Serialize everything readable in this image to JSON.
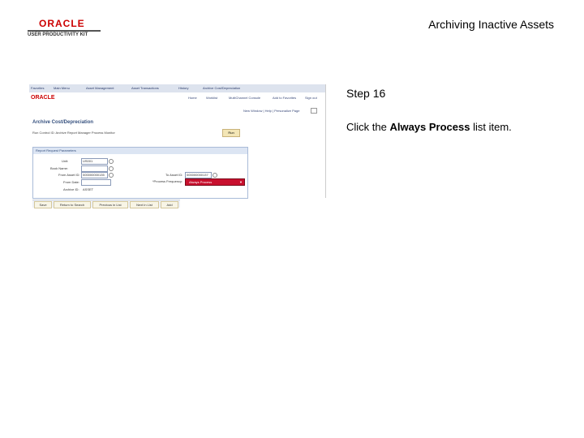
{
  "logo": {
    "brand": "ORACLE",
    "product": "USER PRODUCTIVITY KIT"
  },
  "header": {
    "title": "Archiving Inactive Assets"
  },
  "step": {
    "label": "Step 16"
  },
  "instruction": {
    "prefix": "Click the ",
    "target": "Always Process",
    "suffix": " list item."
  },
  "screenshot": {
    "nav_items": [
      "Favorites",
      "Main Menu",
      "Asset Management",
      "Asset Transactions",
      "History",
      "Archive Cost/Depreciation"
    ],
    "brand": "ORACLE",
    "header_links": [
      "Home",
      "Worklist",
      "MultiChannel Console",
      "Add to Favorites",
      "Sign out"
    ],
    "util_links": "New Window | Help | Personalize Page",
    "page_title": "Archive Cost/Depreciation",
    "context_line": "Run Control ID: Archive   Report Manager   Process Monitor",
    "run_button": "Run",
    "panel_title": "Report Request Parameters",
    "fields": {
      "unit_label": "Unit:",
      "unit_value": "US001",
      "book_label": "Book Name:",
      "book_value": "",
      "from_asset_label": "From Asset ID:",
      "from_asset_value": "000000000135",
      "from_date_label": "From Date:",
      "from_date_value": "",
      "to_asset_label": "To Asset ID:",
      "to_asset_value": "000000000137",
      "archive_id_label": "Archive ID:",
      "archive_id_value": "ASSET",
      "frequency_label": "*Process Frequency:",
      "frequency_value": "Always Process"
    },
    "bottom_buttons": [
      "Save",
      "Return to Search",
      "Previous in List",
      "Next in List",
      "Add"
    ]
  }
}
